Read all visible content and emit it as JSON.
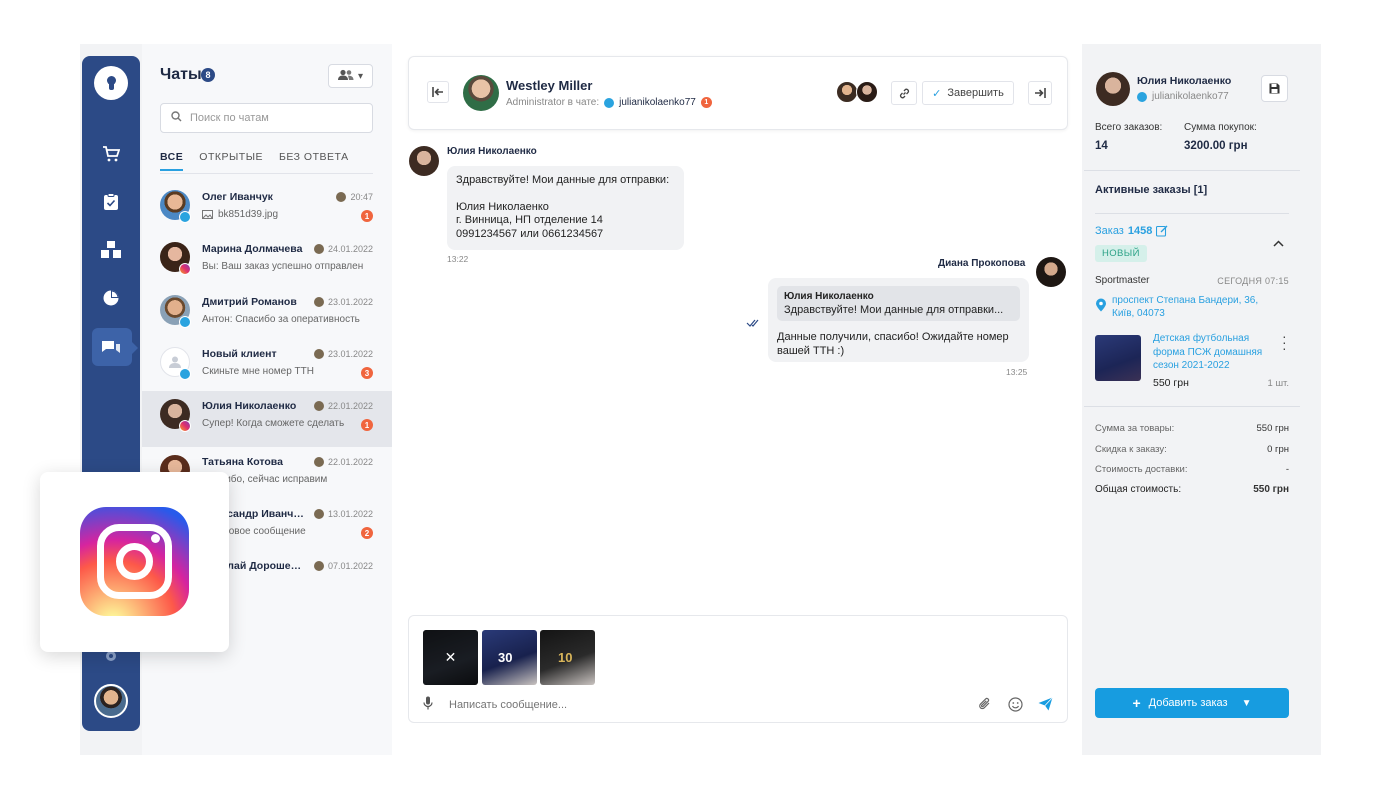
{
  "rail": {
    "icons": [
      "keyhole-logo",
      "cart-icon",
      "clipboard-icon",
      "boxes-icon",
      "pie-chart-icon",
      "chat-icon",
      "settings-icon"
    ]
  },
  "list": {
    "title": "Чаты",
    "count": "8",
    "search_placeholder": "Поиск по чатам",
    "tabs": [
      "ВСЕ",
      "ОТКРЫТЫЕ",
      "БЕЗ ОТВЕТА"
    ],
    "items": [
      {
        "name": "Олег Иванчук",
        "date": "20:47",
        "msg": "bk851d39.jpg",
        "unread": "1",
        "channel": "telegram"
      },
      {
        "name": "Марина Долмачева",
        "date": "24.01.2022",
        "msg": "Вы: Ваш заказ успешно отправлен",
        "unread": "",
        "channel": "instagram"
      },
      {
        "name": "Дмитрий Романов",
        "date": "23.01.2022",
        "msg": "Антон: Спасибо за оперативность",
        "unread": "",
        "channel": "telegram"
      },
      {
        "name": "Новый клиент",
        "date": "23.01.2022",
        "msg": "Скиньте мне номер ТТН",
        "unread": "3",
        "channel": "telegram"
      },
      {
        "name": "Юлия Николаенко",
        "date": "22.01.2022",
        "msg": "Супер! Когда сможете сделать",
        "unread": "1",
        "channel": "instagram"
      },
      {
        "name": "Татьяна Котова",
        "date": "22.01.2022",
        "msg": "Спасибо, сейчас исправим",
        "unread": "",
        "channel": "telegram"
      },
      {
        "name": "Александр Иванченко",
        "date": "13.01.2022",
        "msg": "Голосовое сообщение",
        "unread": "2",
        "channel": "telegram"
      },
      {
        "name": "Николай Дорошенко",
        "date": "07.01.2022",
        "msg": "😄",
        "unread": "",
        "channel": "telegram"
      }
    ]
  },
  "header": {
    "name": "Westley Miller",
    "sub_label": "Administrator в чате:",
    "sub_user": "julianikolaenko77",
    "sub_badge": "1",
    "finish_label": "Завершить"
  },
  "messages": {
    "m1_author": "Юлия Николаенко",
    "m1_lines": [
      "Здравствуйте! Мои данные для отправки:",
      "",
      "Юлия Николаенко",
      "г. Винница, НП отделение 14",
      "0991234567 или 0661234567"
    ],
    "m1_time": "13:22",
    "m2_author": "Диана Прокопова",
    "m2_quote_author": "Юлия Николаенко",
    "m2_quote_text": "Здравствуйте! Мои данные для отправки...",
    "m2_lines": [
      "Данные получили, спасибо! Ожидайте номер",
      "вашей ТТН :)"
    ],
    "m2_time": "13:25"
  },
  "composer": {
    "placeholder": "Написать сообщение..."
  },
  "right": {
    "name": "Юлия Николаенко",
    "username": "julianikolaenko77",
    "total_orders_label": "Всего заказов:",
    "total_orders": "14",
    "total_sum_label": "Сумма покупок:",
    "total_sum": "3200.00 грн",
    "active_orders": "Активные заказы [1]",
    "order_label": "Заказ",
    "order_number": "1458",
    "order_status": "НОВЫЙ",
    "store": "Sportmaster",
    "order_date": "СЕГОДНЯ 07:15",
    "address": "проспект Степана Бандери, 36, Київ, 04073",
    "product_name": "Детская футбольная форма ПСЖ домашняя сезон 2021-2022",
    "product_price": "550 грн",
    "product_qty": "1 шт.",
    "summary": [
      {
        "label": "Сумма за товары:",
        "value": "550 грн"
      },
      {
        "label": "Скидка к заказу:",
        "value": "0 грн"
      },
      {
        "label": "Стоимость доставки:",
        "value": "-"
      }
    ],
    "total_label": "Общая стоимость:",
    "total_value": "550 грн",
    "add_order": "Добавить заказ"
  },
  "colors": {
    "rail": "#2c4a86",
    "accent": "#29a0e0",
    "unread": "#f0653e",
    "status_bg": "#d5f0ea"
  }
}
